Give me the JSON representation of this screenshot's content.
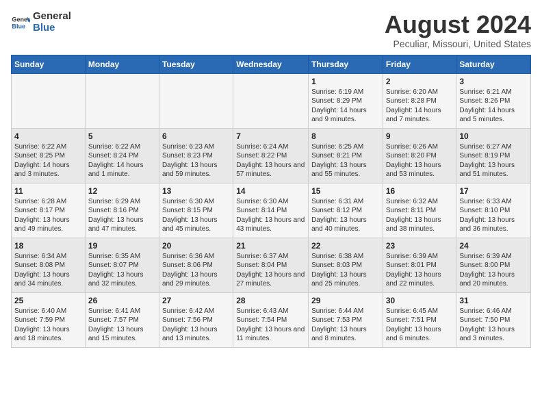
{
  "header": {
    "logo_line1": "General",
    "logo_line2": "Blue",
    "title": "August 2024",
    "subtitle": "Peculiar, Missouri, United States"
  },
  "days_of_week": [
    "Sunday",
    "Monday",
    "Tuesday",
    "Wednesday",
    "Thursday",
    "Friday",
    "Saturday"
  ],
  "weeks": [
    [
      {
        "day": "",
        "info": ""
      },
      {
        "day": "",
        "info": ""
      },
      {
        "day": "",
        "info": ""
      },
      {
        "day": "",
        "info": ""
      },
      {
        "day": "1",
        "info": "Sunrise: 6:19 AM\nSunset: 8:29 PM\nDaylight: 14 hours and 9 minutes."
      },
      {
        "day": "2",
        "info": "Sunrise: 6:20 AM\nSunset: 8:28 PM\nDaylight: 14 hours and 7 minutes."
      },
      {
        "day": "3",
        "info": "Sunrise: 6:21 AM\nSunset: 8:26 PM\nDaylight: 14 hours and 5 minutes."
      }
    ],
    [
      {
        "day": "4",
        "info": "Sunrise: 6:22 AM\nSunset: 8:25 PM\nDaylight: 14 hours and 3 minutes."
      },
      {
        "day": "5",
        "info": "Sunrise: 6:22 AM\nSunset: 8:24 PM\nDaylight: 14 hours and 1 minute."
      },
      {
        "day": "6",
        "info": "Sunrise: 6:23 AM\nSunset: 8:23 PM\nDaylight: 13 hours and 59 minutes."
      },
      {
        "day": "7",
        "info": "Sunrise: 6:24 AM\nSunset: 8:22 PM\nDaylight: 13 hours and 57 minutes."
      },
      {
        "day": "8",
        "info": "Sunrise: 6:25 AM\nSunset: 8:21 PM\nDaylight: 13 hours and 55 minutes."
      },
      {
        "day": "9",
        "info": "Sunrise: 6:26 AM\nSunset: 8:20 PM\nDaylight: 13 hours and 53 minutes."
      },
      {
        "day": "10",
        "info": "Sunrise: 6:27 AM\nSunset: 8:19 PM\nDaylight: 13 hours and 51 minutes."
      }
    ],
    [
      {
        "day": "11",
        "info": "Sunrise: 6:28 AM\nSunset: 8:17 PM\nDaylight: 13 hours and 49 minutes."
      },
      {
        "day": "12",
        "info": "Sunrise: 6:29 AM\nSunset: 8:16 PM\nDaylight: 13 hours and 47 minutes."
      },
      {
        "day": "13",
        "info": "Sunrise: 6:30 AM\nSunset: 8:15 PM\nDaylight: 13 hours and 45 minutes."
      },
      {
        "day": "14",
        "info": "Sunrise: 6:30 AM\nSunset: 8:14 PM\nDaylight: 13 hours and 43 minutes."
      },
      {
        "day": "15",
        "info": "Sunrise: 6:31 AM\nSunset: 8:12 PM\nDaylight: 13 hours and 40 minutes."
      },
      {
        "day": "16",
        "info": "Sunrise: 6:32 AM\nSunset: 8:11 PM\nDaylight: 13 hours and 38 minutes."
      },
      {
        "day": "17",
        "info": "Sunrise: 6:33 AM\nSunset: 8:10 PM\nDaylight: 13 hours and 36 minutes."
      }
    ],
    [
      {
        "day": "18",
        "info": "Sunrise: 6:34 AM\nSunset: 8:08 PM\nDaylight: 13 hours and 34 minutes."
      },
      {
        "day": "19",
        "info": "Sunrise: 6:35 AM\nSunset: 8:07 PM\nDaylight: 13 hours and 32 minutes."
      },
      {
        "day": "20",
        "info": "Sunrise: 6:36 AM\nSunset: 8:06 PM\nDaylight: 13 hours and 29 minutes."
      },
      {
        "day": "21",
        "info": "Sunrise: 6:37 AM\nSunset: 8:04 PM\nDaylight: 13 hours and 27 minutes."
      },
      {
        "day": "22",
        "info": "Sunrise: 6:38 AM\nSunset: 8:03 PM\nDaylight: 13 hours and 25 minutes."
      },
      {
        "day": "23",
        "info": "Sunrise: 6:39 AM\nSunset: 8:01 PM\nDaylight: 13 hours and 22 minutes."
      },
      {
        "day": "24",
        "info": "Sunrise: 6:39 AM\nSunset: 8:00 PM\nDaylight: 13 hours and 20 minutes."
      }
    ],
    [
      {
        "day": "25",
        "info": "Sunrise: 6:40 AM\nSunset: 7:59 PM\nDaylight: 13 hours and 18 minutes."
      },
      {
        "day": "26",
        "info": "Sunrise: 6:41 AM\nSunset: 7:57 PM\nDaylight: 13 hours and 15 minutes."
      },
      {
        "day": "27",
        "info": "Sunrise: 6:42 AM\nSunset: 7:56 PM\nDaylight: 13 hours and 13 minutes."
      },
      {
        "day": "28",
        "info": "Sunrise: 6:43 AM\nSunset: 7:54 PM\nDaylight: 13 hours and 11 minutes."
      },
      {
        "day": "29",
        "info": "Sunrise: 6:44 AM\nSunset: 7:53 PM\nDaylight: 13 hours and 8 minutes."
      },
      {
        "day": "30",
        "info": "Sunrise: 6:45 AM\nSunset: 7:51 PM\nDaylight: 13 hours and 6 minutes."
      },
      {
        "day": "31",
        "info": "Sunrise: 6:46 AM\nSunset: 7:50 PM\nDaylight: 13 hours and 3 minutes."
      }
    ]
  ]
}
